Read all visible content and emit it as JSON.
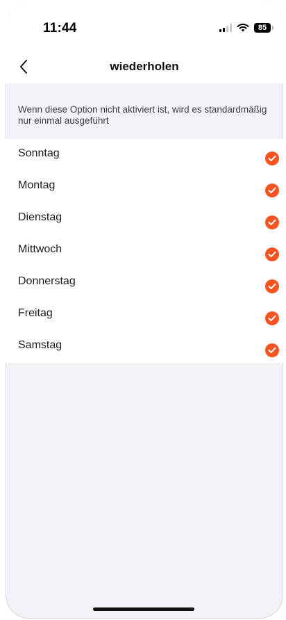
{
  "status_bar": {
    "time": "11:44",
    "battery_level": "85"
  },
  "nav": {
    "title": "wiederholen",
    "back_icon": "chevron-left-icon"
  },
  "hint": "Wenn diese Option nicht aktiviert ist, wird es standardmäßig nur einmal ausgeführt",
  "accent_color": "#f5531f",
  "days": [
    {
      "label": "Sonntag",
      "checked": true
    },
    {
      "label": "Montag",
      "checked": true
    },
    {
      "label": "Dienstag",
      "checked": true
    },
    {
      "label": "Mittwoch",
      "checked": true
    },
    {
      "label": "Donnerstag",
      "checked": true
    },
    {
      "label": "Freitag",
      "checked": true
    },
    {
      "label": "Samstag",
      "checked": true
    }
  ]
}
